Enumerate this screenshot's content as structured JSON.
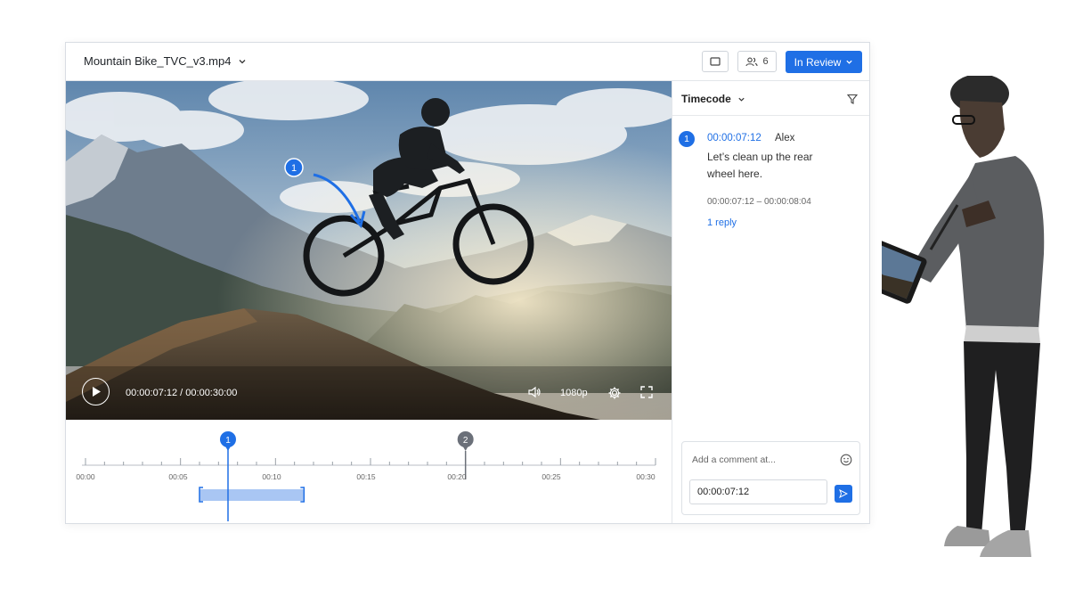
{
  "header": {
    "file_name": "Mountain Bike_TVC_v3.mp4",
    "viewers_count": "6",
    "status_label": "In Review"
  },
  "player": {
    "annotation_number": "1",
    "time_display": "00:00:07:12 / 00:00:30:00",
    "quality": "1080p"
  },
  "timeline": {
    "ticks": [
      "00:00",
      "00:05",
      "00:10",
      "00:15",
      "00:20",
      "00:25",
      "00:30"
    ],
    "markers": [
      "1",
      "2"
    ],
    "playhead_seconds": 7.5,
    "range_seconds": [
      6.0,
      11.5
    ],
    "duration_seconds": 30
  },
  "panel": {
    "sort_label": "Timecode",
    "comment": {
      "number": "1",
      "timecode": "00:00:07:12",
      "author": "Alex",
      "text_line1": "Let’s clean up the rear",
      "text_line2": "wheel here.",
      "range": "00:00:07:12 – 00:00:08:04",
      "replies": "1 reply"
    },
    "composer": {
      "placeholder": "Add a comment at...",
      "timecode_value": "00:00:07:12"
    }
  },
  "colors": {
    "accent": "#1f6fe5",
    "marker_gray": "#6b7079"
  }
}
